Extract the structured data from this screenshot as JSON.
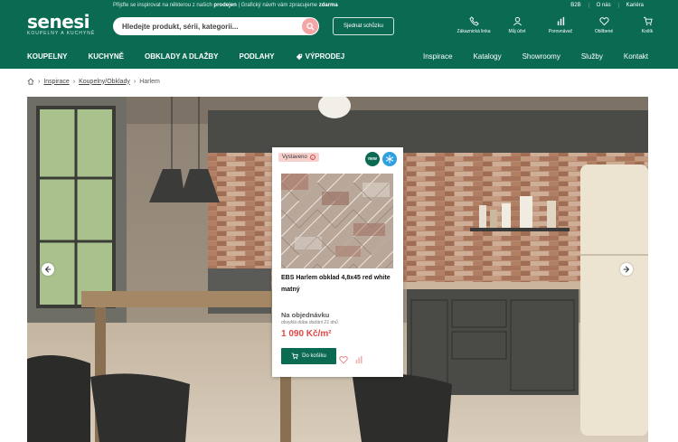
{
  "header": {
    "top_text_prefix": "Přijďte se inspirovat na některou z našich",
    "top_text_link1": "prodejen",
    "top_text_mid": "| Grafický návrh vám zpracujeme",
    "top_text_link2": "zdarma",
    "top_links": [
      "B2B",
      "O nás",
      "Kariéra"
    ],
    "logo_name": "senesi",
    "logo_sub": "KOUPELNY A KUCHYNĚ",
    "search_placeholder": "Hledejte produkt, sérii, kategorii...",
    "meeting_button": "Sjednat schůzku",
    "icons": [
      {
        "icon": "phone-icon",
        "label": "Zákaznická linka"
      },
      {
        "icon": "user-icon",
        "label": "Můj účet"
      },
      {
        "icon": "compare-icon",
        "label": "Porovnávač"
      },
      {
        "icon": "heart-icon",
        "label": "Oblíbené"
      },
      {
        "icon": "cart-icon",
        "label": "Košík"
      }
    ]
  },
  "nav": {
    "left": [
      "KOUPELNY",
      "KUCHYNĚ",
      "OBKLADY A DLAŽBY",
      "PODLAHY",
      "VÝPRODEJ"
    ],
    "right": [
      "Inspirace",
      "Katalogy",
      "Showroomy",
      "Služby",
      "Kontakt"
    ]
  },
  "breadcrumb": {
    "items": [
      "Inspirace",
      "Koupelny/Obklady"
    ],
    "current": "Harlem"
  },
  "product": {
    "badge_status": "Vystaveno",
    "badge_new": "new",
    "title": "EBS Harlem obklad 4,8x45 red white matný",
    "availability": "Na objednávku",
    "delivery": "obvyklá doba dodání 21 dnů",
    "price": "1 090 Kč/m²",
    "cart_button": "Do košíku"
  },
  "colors": {
    "brand": "#0a6b52",
    "price": "#e04848",
    "badge": "#f6d1cd"
  }
}
